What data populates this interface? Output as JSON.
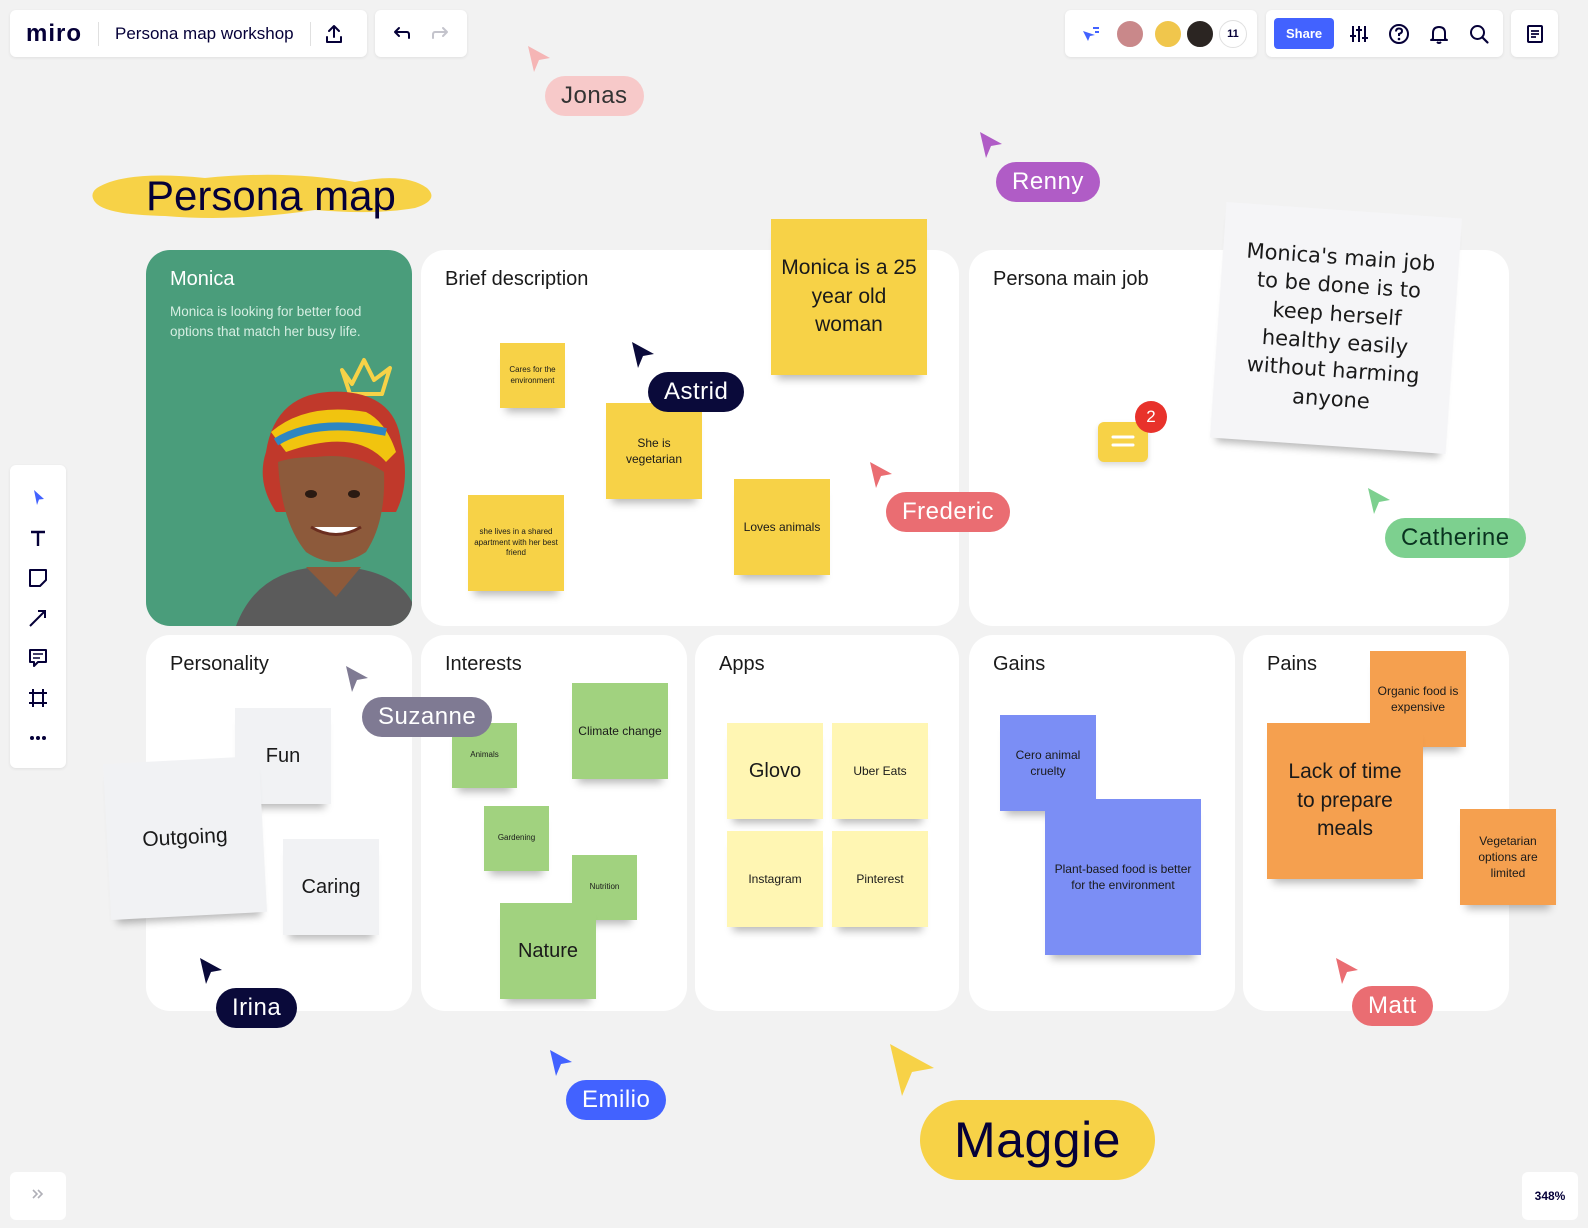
{
  "app": {
    "logo": "miro",
    "board_title": "Persona map workshop",
    "share_label": "Share",
    "collaborator_count": "11",
    "zoom": "348%"
  },
  "colors": {
    "accent": "#4262ff",
    "sticky_yellow": "#f7d247",
    "persona_green": "#4a9d7b"
  },
  "heading": "Persona map",
  "persona": {
    "name": "Monica",
    "description": "Monica is looking for better food options that match her busy life."
  },
  "panels": {
    "brief_description": "Brief description",
    "persona_main_job": "Persona main job",
    "personality": "Personality",
    "interests": "Interests",
    "apps": "Apps",
    "gains": "Gains",
    "pains": "Pains"
  },
  "stickies": {
    "brief": {
      "age": "Monica is a 25 year old woman",
      "environment": "Cares for the environment",
      "vegetarian": "She is vegetarian",
      "apartment": "she lives in a shared apartment with her best friend",
      "animals": "Loves animals"
    },
    "main_job": "Monica's main job to be done is to keep herself healthy easily without harming anyone",
    "comment_count": "2",
    "personality": {
      "fun": "Fun",
      "outgoing": "Outgoing",
      "caring": "Caring"
    },
    "interests": {
      "animals": "Animals",
      "climate": "Climate change",
      "gardening": "Gardening",
      "nutrition": "Nutrition",
      "nature": "Nature"
    },
    "apps": {
      "glovo": "Glovo",
      "uber_eats": "Uber Eats",
      "instagram": "Instagram",
      "pinterest": "Pinterest"
    },
    "gains": {
      "cruelty": "Cero animal cruelty",
      "plant_based": "Plant-based food is better for the environment"
    },
    "pains": {
      "organic": "Organic food is expensive",
      "time": "Lack of time to prepare meals",
      "vegetarian": "Vegetarian options are limited"
    }
  },
  "cursors": {
    "jonas": "Jonas",
    "renny": "Renny",
    "astrid": "Astrid",
    "frederic": "Frederic",
    "catherine": "Catherine",
    "suzanne": "Suzanne",
    "irina": "Irina",
    "emilio": "Emilio",
    "maggie": "Maggie",
    "matt": "Matt"
  },
  "icons": {
    "toolbar": [
      "cursor-icon",
      "text-icon",
      "sticky-note-icon",
      "line-icon",
      "comment-icon",
      "frame-icon",
      "more-icon"
    ],
    "top": [
      "upload-icon",
      "undo-icon",
      "redo-icon",
      "cursor-follow-icon",
      "settings-icon",
      "help-icon",
      "bell-icon",
      "search-icon",
      "notes-icon"
    ]
  }
}
